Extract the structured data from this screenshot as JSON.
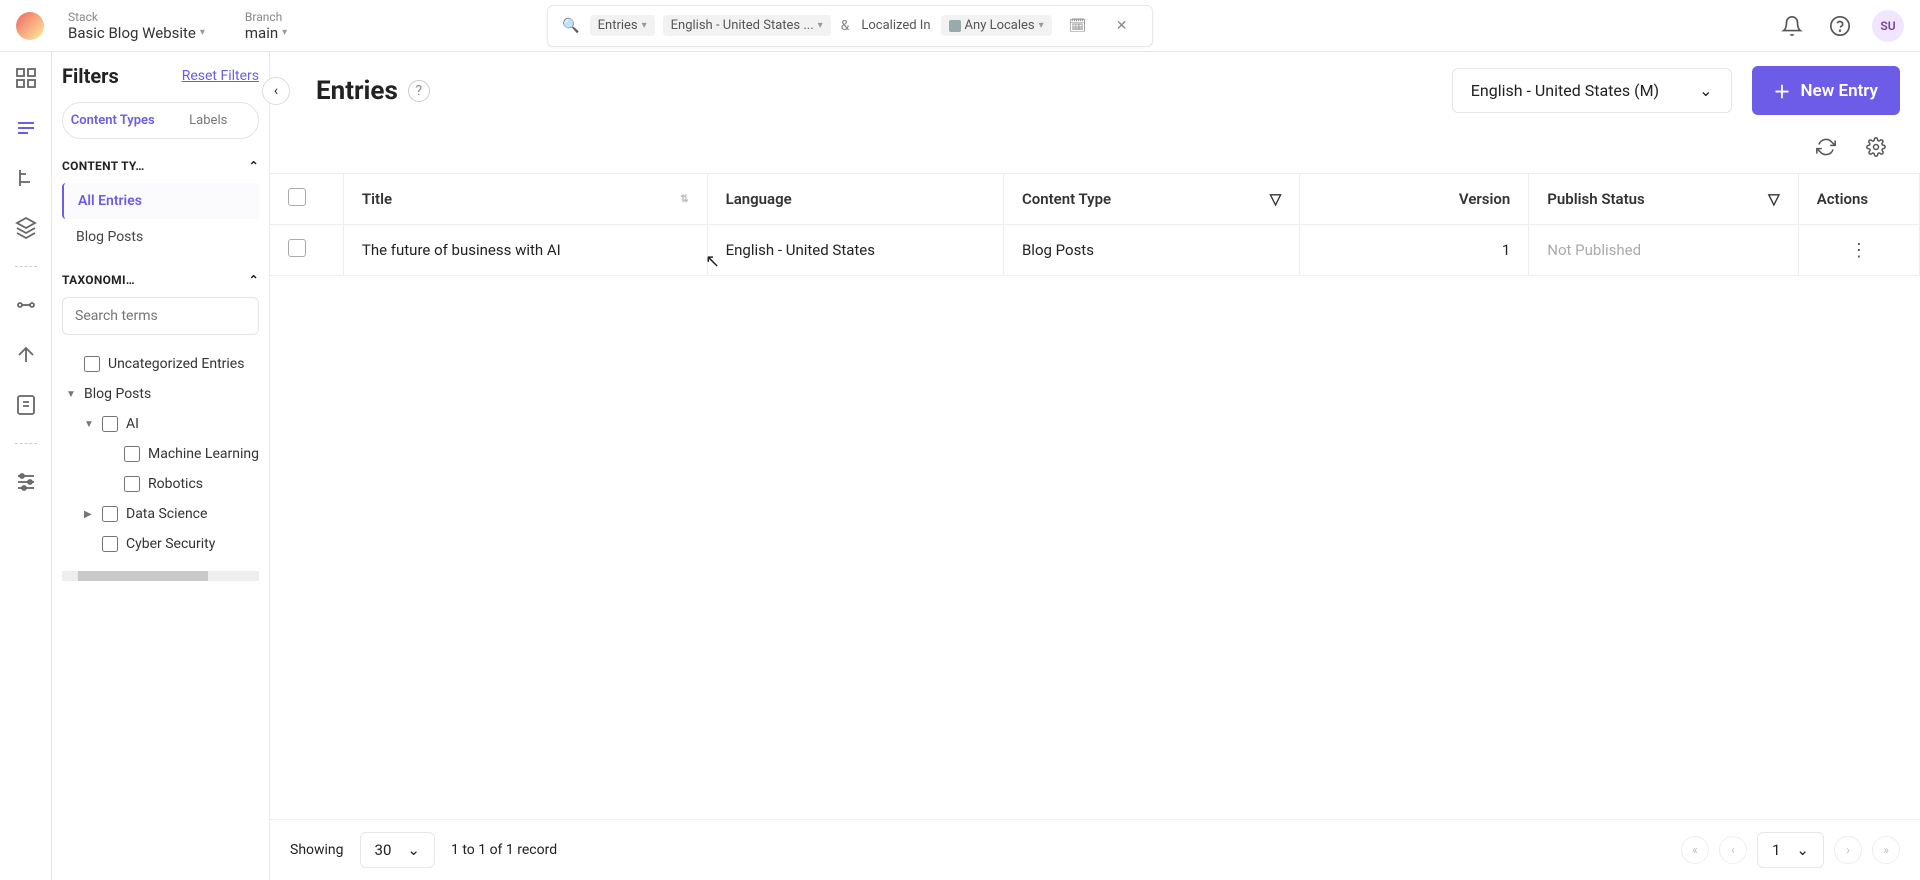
{
  "header": {
    "stack_label": "Stack",
    "stack_value": "Basic Blog Website",
    "branch_label": "Branch",
    "branch_value": "main",
    "user_initials": "SU"
  },
  "search": {
    "scope": "Entries",
    "language": "English - United States ...",
    "and": "&",
    "localized_label": "Localized In",
    "localized_value": "Any Locales"
  },
  "filters": {
    "title": "Filters",
    "reset": "Reset Filters",
    "tabs": {
      "content_types": "Content Types",
      "labels": "Labels"
    },
    "section_content_type": "CONTENT TY…",
    "items": {
      "all_entries": "All Entries",
      "blog_posts": "Blog Posts"
    },
    "section_taxonomies": "TAXONOMI…",
    "search_placeholder": "Search terms",
    "tax": {
      "uncategorized": "Uncategorized Entries",
      "blog_posts": "Blog Posts",
      "ai": "AI",
      "ml": "Machine Learning",
      "robotics": "Robotics",
      "data_science": "Data Science",
      "cyber_security": "Cyber Security"
    }
  },
  "main": {
    "title": "Entries",
    "language_selector": "English - United States (M)",
    "new_entry": "New Entry"
  },
  "columns": {
    "title": "Title",
    "language": "Language",
    "content_type": "Content Type",
    "version": "Version",
    "publish_status": "Publish Status",
    "actions": "Actions"
  },
  "rows": [
    {
      "title": "The future of business with AI",
      "language": "English - United States",
      "content_type": "Blog Posts",
      "version": "1",
      "publish_status": "Not Published"
    }
  ],
  "pager": {
    "showing": "Showing",
    "per_page": "30",
    "summary": "1 to 1 of 1 record",
    "page": "1"
  }
}
